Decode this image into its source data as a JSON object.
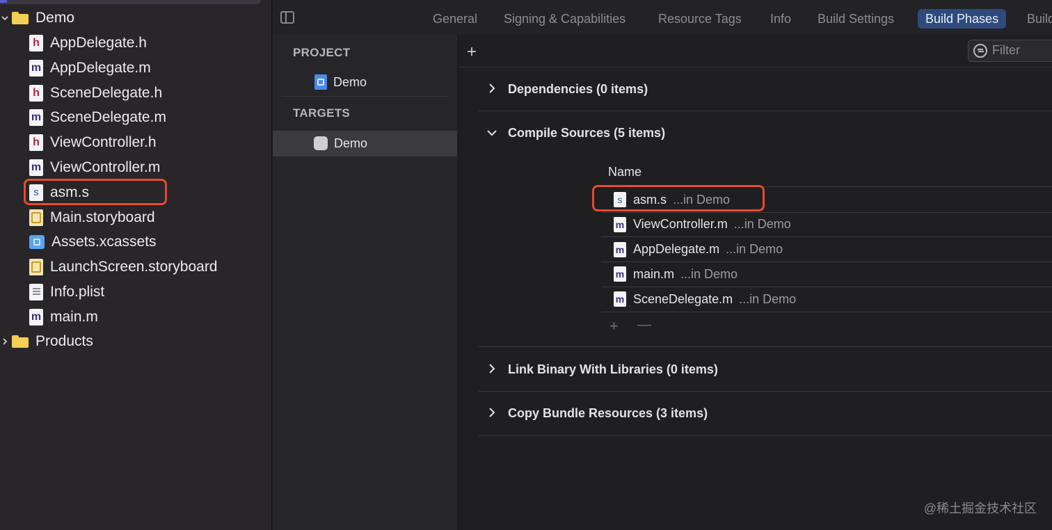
{
  "navigator": {
    "group": "Demo",
    "files": [
      {
        "name": "AppDelegate.h",
        "type": "h",
        "glyph": "h"
      },
      {
        "name": "AppDelegate.m",
        "type": "m",
        "glyph": "m"
      },
      {
        "name": "SceneDelegate.h",
        "type": "h",
        "glyph": "h"
      },
      {
        "name": "SceneDelegate.m",
        "type": "m",
        "glyph": "m"
      },
      {
        "name": "ViewController.h",
        "type": "h",
        "glyph": "h"
      },
      {
        "name": "ViewController.m",
        "type": "m",
        "glyph": "m"
      },
      {
        "name": "asm.s",
        "type": "s",
        "glyph": "s"
      },
      {
        "name": "Main.storyboard",
        "type": "storyboard",
        "glyph": ""
      },
      {
        "name": "Assets.xcassets",
        "type": "assets",
        "glyph": ""
      },
      {
        "name": "LaunchScreen.storyboard",
        "type": "storyboard",
        "glyph": ""
      },
      {
        "name": "Info.plist",
        "type": "plist",
        "glyph": ""
      },
      {
        "name": "main.m",
        "type": "m",
        "glyph": "m"
      }
    ],
    "products": "Products"
  },
  "tabs": [
    "General",
    "Signing & Capabilities",
    "Resource Tags",
    "Info",
    "Build Settings",
    "Build Phases",
    "Build Rules"
  ],
  "active_tab": "Build Phases",
  "targets_panel": {
    "project_header": "PROJECT",
    "project_item": "Demo",
    "targets_header": "TARGETS",
    "target_item": "Demo"
  },
  "build_phases": {
    "add_symbol": "+",
    "filter_placeholder": "Filter",
    "phases": [
      {
        "title": "Dependencies (0 items)",
        "expanded": false
      },
      {
        "title": "Compile Sources (5 items)",
        "expanded": true
      },
      {
        "title": "Link Binary With Libraries (0 items)",
        "expanded": false
      },
      {
        "title": "Copy Bundle Resources (3 items)",
        "expanded": false
      }
    ],
    "compile_sources": {
      "column_name": "Name",
      "rows": [
        {
          "name": "asm.s",
          "location": "...in Demo",
          "glyph": "s"
        },
        {
          "name": "ViewController.m",
          "location": "...in Demo",
          "glyph": "m"
        },
        {
          "name": "AppDelegate.m",
          "location": "...in Demo",
          "glyph": "m"
        },
        {
          "name": "main.m",
          "location": "...in Demo",
          "glyph": "m"
        },
        {
          "name": "SceneDelegate.m",
          "location": "...in Demo",
          "glyph": "m"
        }
      ],
      "add_symbol": "+",
      "remove_symbol": "—"
    }
  },
  "watermark": "@稀土掘金技术社区",
  "colors": {
    "highlight": "#e64b2e",
    "active_tab": "#2f4a7c",
    "folder": "#f5cf55"
  }
}
